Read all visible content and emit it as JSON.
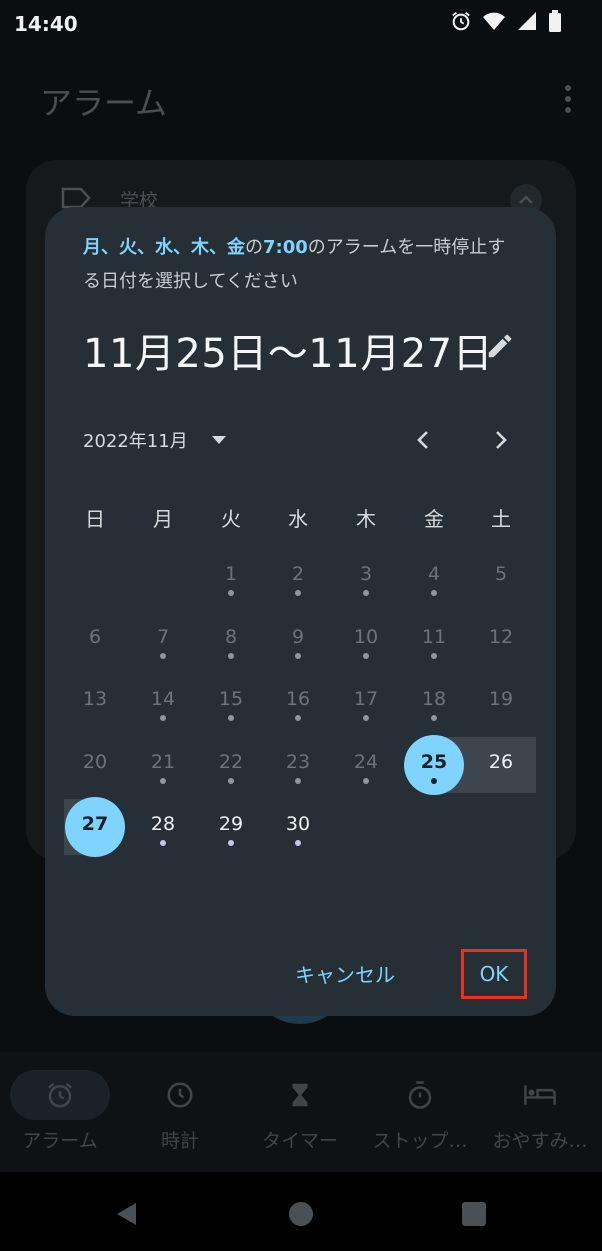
{
  "status": {
    "time": "14:40",
    "icons": [
      "alarm-icon",
      "wifi-icon",
      "cellular-icon",
      "battery-icon"
    ]
  },
  "appbar": {
    "title": "アラーム"
  },
  "background_card": {
    "label": "学校"
  },
  "dialog": {
    "message_days": "月、火、水、木、金",
    "message_mid": "の",
    "message_time": "7:00",
    "message_rest": "のアラームを一時停止する日付を選択してください",
    "range_text": "11月25日～11月27日",
    "month_label": "2022年11月",
    "weekdays": [
      "日",
      "月",
      "火",
      "水",
      "木",
      "金",
      "土"
    ],
    "cancel_label": "キャンセル",
    "ok_label": "OK"
  },
  "calendar": {
    "days": [
      {
        "n": "1"
      },
      {
        "n": "2"
      },
      {
        "n": "3"
      },
      {
        "n": "4"
      },
      {
        "n": "5"
      },
      {
        "n": "6"
      },
      {
        "n": "7"
      },
      {
        "n": "8"
      },
      {
        "n": "9"
      },
      {
        "n": "10"
      },
      {
        "n": "11"
      },
      {
        "n": "12"
      },
      {
        "n": "13"
      },
      {
        "n": "14"
      },
      {
        "n": "15"
      },
      {
        "n": "16"
      },
      {
        "n": "17"
      },
      {
        "n": "18"
      },
      {
        "n": "19"
      },
      {
        "n": "20"
      },
      {
        "n": "21"
      },
      {
        "n": "22"
      },
      {
        "n": "23"
      },
      {
        "n": "24"
      },
      {
        "n": "25"
      },
      {
        "n": "26"
      },
      {
        "n": "27"
      },
      {
        "n": "28"
      },
      {
        "n": "29"
      },
      {
        "n": "30"
      }
    ],
    "range_start": 25,
    "range_end": 27
  },
  "bottom_nav": {
    "items": [
      {
        "label": "アラーム",
        "icon": "alarm-icon"
      },
      {
        "label": "時計",
        "icon": "clock-icon"
      },
      {
        "label": "タイマー",
        "icon": "hourglass-icon"
      },
      {
        "label": "ストップ…",
        "icon": "stopwatch-icon"
      },
      {
        "label": "おやすみ…",
        "icon": "bed-icon"
      }
    ]
  },
  "colors": {
    "accent": "#7fd3ff",
    "dialog_bg": "#262f35",
    "highlight_border": "#e8321b"
  }
}
